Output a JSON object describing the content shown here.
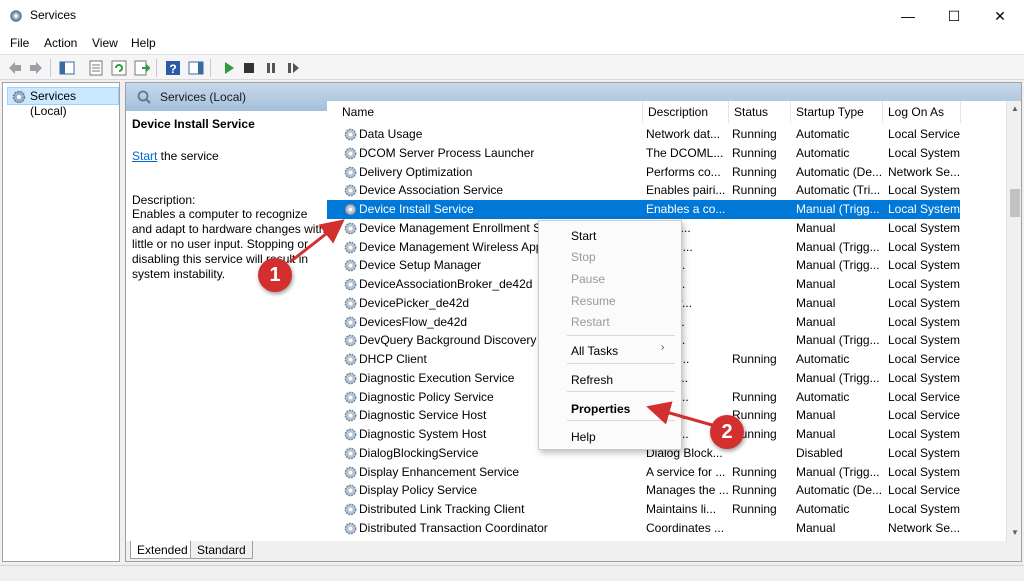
{
  "window": {
    "title": "Services",
    "icons": {
      "app": "gear-icon",
      "minimize": "minimize-icon",
      "maximize": "maximize-icon",
      "close": "close-icon"
    }
  },
  "menu": [
    "File",
    "Action",
    "View",
    "Help"
  ],
  "toolbar": {
    "icons": [
      "back-arrow-icon",
      "forward-arrow-icon",
      "show-hide-console-tree-icon",
      "properties-icon",
      "refresh-icon",
      "export-list-icon",
      "help-icon",
      "show-hide-action-pane-icon",
      "start-service-icon",
      "stop-service-icon",
      "pause-service-icon",
      "restart-service-icon"
    ]
  },
  "tree": {
    "root": "Services (Local)"
  },
  "pane": {
    "header": "Services (Local)"
  },
  "details": {
    "title": "Device Install Service",
    "start_link": "Start",
    "start_suffix": " the service",
    "description_label": "Description:",
    "description": "Enables a computer to recognize and adapt to hardware changes with little or no user input. Stopping or disabling this service will result in system instability."
  },
  "columns": [
    "Name",
    "Description",
    "Status",
    "Startup Type",
    "Log On As"
  ],
  "rows": [
    {
      "name": "Data Usage",
      "description": "Network dat...",
      "status": "Running",
      "startup": "Automatic",
      "logon": "Local Service"
    },
    {
      "name": "DCOM Server Process Launcher",
      "description": "The DCOML...",
      "status": "Running",
      "startup": "Automatic",
      "logon": "Local System"
    },
    {
      "name": "Delivery Optimization",
      "description": "Performs co...",
      "status": "Running",
      "startup": "Automatic (De...",
      "logon": "Network Se..."
    },
    {
      "name": "Device Association Service",
      "description": "Enables pairi...",
      "status": "Running",
      "startup": "Automatic (Tri...",
      "logon": "Local System"
    },
    {
      "name": "Device Install Service",
      "description": "Enables a co...",
      "status": "",
      "startup": "Manual (Trigg...",
      "logon": "Local System",
      "selected": true
    },
    {
      "name": "Device Management Enrollment Se",
      "description": "ms De...",
      "status": "",
      "startup": "Manual",
      "logon": "Local System"
    },
    {
      "name": "Device Management Wireless Appli",
      "description": "s Wirel...",
      "status": "",
      "startup": "Manual (Trigg...",
      "logon": "Local System"
    },
    {
      "name": "Device Setup Manager",
      "description": "s the ...",
      "status": "",
      "startup": "Manual (Trigg...",
      "logon": "Local System"
    },
    {
      "name": "DeviceAssociationBroker_de42d",
      "description": "s app...",
      "status": "",
      "startup": "Manual",
      "logon": "Local System"
    },
    {
      "name": "DevicePicker_de42d",
      "description": "ser ser...",
      "status": "",
      "startup": "Manual",
      "logon": "Local System"
    },
    {
      "name": "DevicesFlow_de42d",
      "description": "Conn...",
      "status": "",
      "startup": "Manual",
      "logon": "Local System"
    },
    {
      "name": "DevQuery Background Discovery Br",
      "description": "s app...",
      "status": "",
      "startup": "Manual (Trigg...",
      "logon": "Local System"
    },
    {
      "name": "DHCP Client",
      "description": "ers an...",
      "status": "Running",
      "startup": "Automatic",
      "logon": "Local Service"
    },
    {
      "name": "Diagnostic Execution Service",
      "description": "es dia...",
      "status": "",
      "startup": "Manual (Trigg...",
      "logon": "Local System"
    },
    {
      "name": "Diagnostic Policy Service",
      "description": "agnos...",
      "status": "Running",
      "startup": "Automatic",
      "logon": "Local Service"
    },
    {
      "name": "Diagnostic Service Host",
      "description": "agnos...",
      "status": "Running",
      "startup": "Manual",
      "logon": "Local Service"
    },
    {
      "name": "Diagnostic System Host",
      "description": "agnos...",
      "status": "Running",
      "startup": "Manual",
      "logon": "Local System"
    },
    {
      "name": "DialogBlockingService",
      "description": "Dialog Block...",
      "status": "",
      "startup": "Disabled",
      "logon": "Local System"
    },
    {
      "name": "Display Enhancement Service",
      "description": "A service for ...",
      "status": "Running",
      "startup": "Manual (Trigg...",
      "logon": "Local System"
    },
    {
      "name": "Display Policy Service",
      "description": "Manages the ...",
      "status": "Running",
      "startup": "Automatic (De...",
      "logon": "Local Service"
    },
    {
      "name": "Distributed Link Tracking Client",
      "description": "Maintains li...",
      "status": "Running",
      "startup": "Automatic",
      "logon": "Local System"
    },
    {
      "name": "Distributed Transaction Coordinator",
      "description": "Coordinates ...",
      "status": "",
      "startup": "Manual",
      "logon": "Network Se..."
    }
  ],
  "context_menu": {
    "items": [
      {
        "label": "Start",
        "enabled": true
      },
      {
        "label": "Stop",
        "enabled": false
      },
      {
        "label": "Pause",
        "enabled": false
      },
      {
        "label": "Resume",
        "enabled": false
      },
      {
        "label": "Restart",
        "enabled": false
      },
      {
        "label": "All Tasks",
        "enabled": true,
        "submenu": true
      },
      {
        "label": "Refresh",
        "enabled": true
      },
      {
        "label": "Properties",
        "enabled": true,
        "bold": true
      },
      {
        "label": "Help",
        "enabled": true
      }
    ],
    "submenu_arrow": "›"
  },
  "tabs": [
    "Extended",
    "Standard"
  ],
  "annotations": {
    "badge1": "1",
    "badge2": "2",
    "color": "#d32f2f"
  }
}
